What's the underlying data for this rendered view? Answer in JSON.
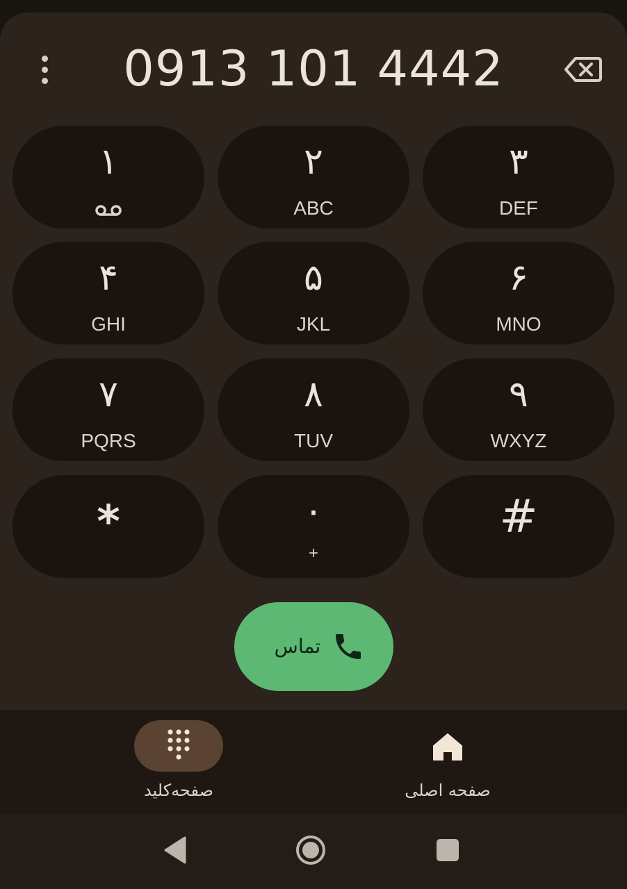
{
  "dialer": {
    "number": "0913 101 4442",
    "keys": [
      {
        "digit": "۱",
        "letters": ""
      },
      {
        "digit": "۲",
        "letters": "ABC"
      },
      {
        "digit": "۳",
        "letters": "DEF"
      },
      {
        "digit": "۴",
        "letters": "GHI"
      },
      {
        "digit": "۵",
        "letters": "JKL"
      },
      {
        "digit": "۶",
        "letters": "MNO"
      },
      {
        "digit": "۷",
        "letters": "PQRS"
      },
      {
        "digit": "۸",
        "letters": "TUV"
      },
      {
        "digit": "۹",
        "letters": "WXYZ"
      },
      {
        "digit": "*",
        "letters": ""
      },
      {
        "digit": "۰",
        "letters": "+"
      },
      {
        "digit": "#",
        "letters": ""
      }
    ],
    "call_label": "تماس"
  },
  "icons": {
    "overflow": "more-vert-icon",
    "backspace": "backspace-icon",
    "voicemail": "voicemail-icon",
    "call": "phone-icon",
    "keypad": "dialpad-icon",
    "home": "home-icon",
    "back": "back-triangle-icon",
    "home_sys": "home-circle-icon",
    "recents": "recents-square-icon"
  },
  "bottom_nav": {
    "keypad_label": "صفحه‌کلید",
    "home_label": "صفحه اصلی"
  },
  "colors": {
    "background": "#2c231c",
    "key": "#1a130f",
    "call_button": "#5db873",
    "active_pill": "#5a4333",
    "text": "#ece4da"
  }
}
